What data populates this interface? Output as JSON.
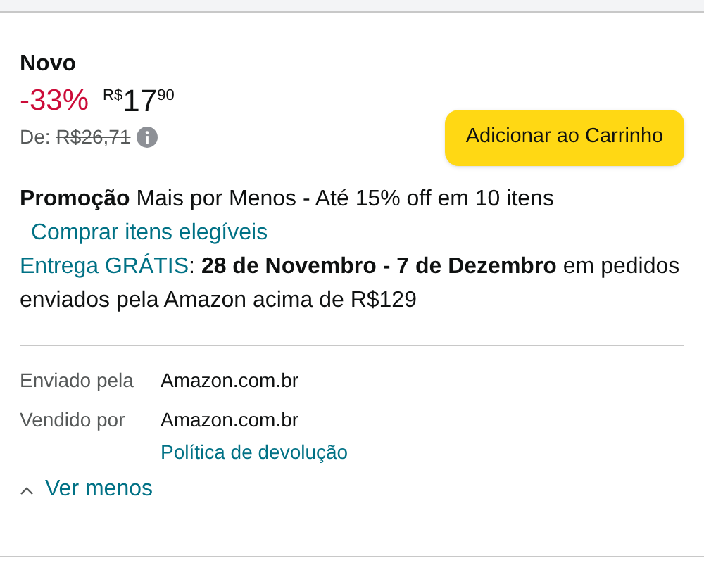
{
  "condition": "Novo",
  "price": {
    "discount": "-33%",
    "currency": "R$",
    "whole": "17",
    "cents": "90"
  },
  "list_price": {
    "label": "De:",
    "value": "R$26,71"
  },
  "add_to_cart_button": "Adicionar ao Carrinho",
  "promotion": {
    "text": "**Promoção** Mais por Menos - Até 15% off em 10 itens",
    "link": "Comprar itens elegíveis"
  },
  "delivery": {
    "link": "Entrega GRÁTIS",
    "text": ": **28 de Novembro - 7 de Dezembro** em pedidos enviados pela Amazon acima de R$129"
  },
  "details": [
    {
      "label": "Enviado pela",
      "value": "Amazon.com.br"
    },
    {
      "label": "Vendido por",
      "value": "Amazon.com.br",
      "link": "Política de devolução"
    }
  ],
  "toggle": {
    "label": "Ver menos",
    "expanded": true
  }
}
